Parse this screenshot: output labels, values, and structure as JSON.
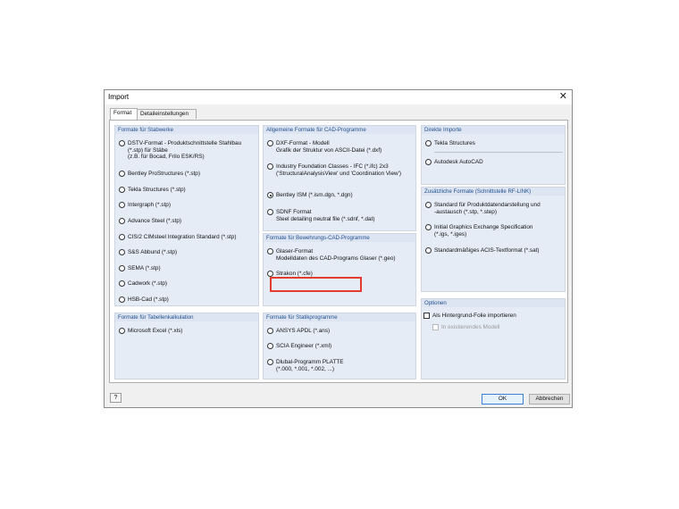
{
  "dialog": {
    "title": "Import",
    "close_glyph": "✕"
  },
  "tabs": [
    {
      "label": "Format",
      "active": true
    },
    {
      "label": "Detaileinstellungen",
      "active": false
    }
  ],
  "groups": {
    "stabwerke": {
      "title": "Formate für Stabwerke",
      "items": [
        {
          "lines": [
            "DSTV-Format - Produktschnittstelle Stahlbau",
            "(*.stp) für Stäbe",
            "(z.B. für Bocad, Frilo ESK/RS)"
          ]
        },
        {
          "lines": [
            "Bentley ProStructures (*.stp)"
          ]
        },
        {
          "lines": [
            "Tekla Structures (*.stp)"
          ]
        },
        {
          "lines": [
            "Intergraph (*.stp)"
          ]
        },
        {
          "lines": [
            "Advance Steel (*.stp)"
          ]
        },
        {
          "lines": [
            "CIS/2 CIMsteel Integration Standard (*.stp)"
          ]
        },
        {
          "lines": [
            "S&S Abbund (*.stp)"
          ]
        },
        {
          "lines": [
            "SEMA (*.stp)"
          ]
        },
        {
          "lines": [
            "Cadwork (*.stp)"
          ]
        },
        {
          "lines": [
            "HSB-Cad (*.stp)"
          ]
        }
      ]
    },
    "cad": {
      "title": "Allgemeine Formate für CAD-Programme",
      "items": [
        {
          "lines": [
            "DXF-Format - Modell",
            "Grafik der Struktur von ASCII-Datei (*.dxf)"
          ]
        },
        {
          "lines": [
            "Industry Foundation Classes - IFC (*.ifc) 2x3",
            "('StructuralAnalysisView' und 'Coordination View')"
          ]
        },
        {
          "lines": [
            "Bentley ISM (*.ism.dgn, *.dgn)"
          ],
          "selected": true
        },
        {
          "lines": [
            "SDNF Format",
            "Steel detailing neutral file (*.sdnf, *.dat)"
          ]
        }
      ]
    },
    "bewehrung": {
      "title": "Formate für Bewehrungs-CAD-Programme",
      "items": [
        {
          "lines": [
            "Glaser-Format",
            "Modelldaten des CAD-Programs Glaser (*.geo)"
          ]
        },
        {
          "lines": [
            "Strakon (*.cfe)"
          ]
        }
      ]
    },
    "direkt": {
      "title": "Direkte Importe",
      "items": [
        {
          "lines": [
            "Tekla Structures"
          ]
        },
        {
          "lines": [
            "Autodesk AutoCAD"
          ]
        }
      ]
    },
    "rflink": {
      "title": "Zusätzliche Formate (Schnittstelle RF-LINK)",
      "items": [
        {
          "lines": [
            "Standard für Produktdatendarstellung und",
            "-austausch (*.stp, *.step)"
          ]
        },
        {
          "lines": [
            "Initial Graphics Exchange Specification",
            "(*.igs, *.iges)"
          ]
        },
        {
          "lines": [
            "Standardmäßiges ACIS-Textformat (*.sat)"
          ]
        }
      ]
    },
    "tabellen": {
      "title": "Formate für Tabellenkalkulation",
      "items": [
        {
          "lines": [
            "Microsoft Excel (*.xls)"
          ]
        }
      ]
    },
    "statik": {
      "title": "Formate für Statikprogramme",
      "items": [
        {
          "lines": [
            "ANSYS APDL (*.ans)"
          ]
        },
        {
          "lines": [
            "SCIA Engineer (*.xml)"
          ]
        },
        {
          "lines": [
            "Dlubal-Programm PLATTE",
            "(*.000, *.001, *.002, ...)"
          ]
        }
      ]
    },
    "optionen": {
      "title": "Optionen",
      "background_foil": "Als Hintergrund-Folie importieren",
      "existing_model": "In existierendes Modell"
    }
  },
  "buttons": {
    "ok": "OK",
    "cancel": "Abbrechen",
    "help_glyph": "?"
  },
  "colors": {
    "group_header_text": "#1f4e8c",
    "group_bg": "#e6ecf6",
    "highlight": "#e53b2f"
  }
}
